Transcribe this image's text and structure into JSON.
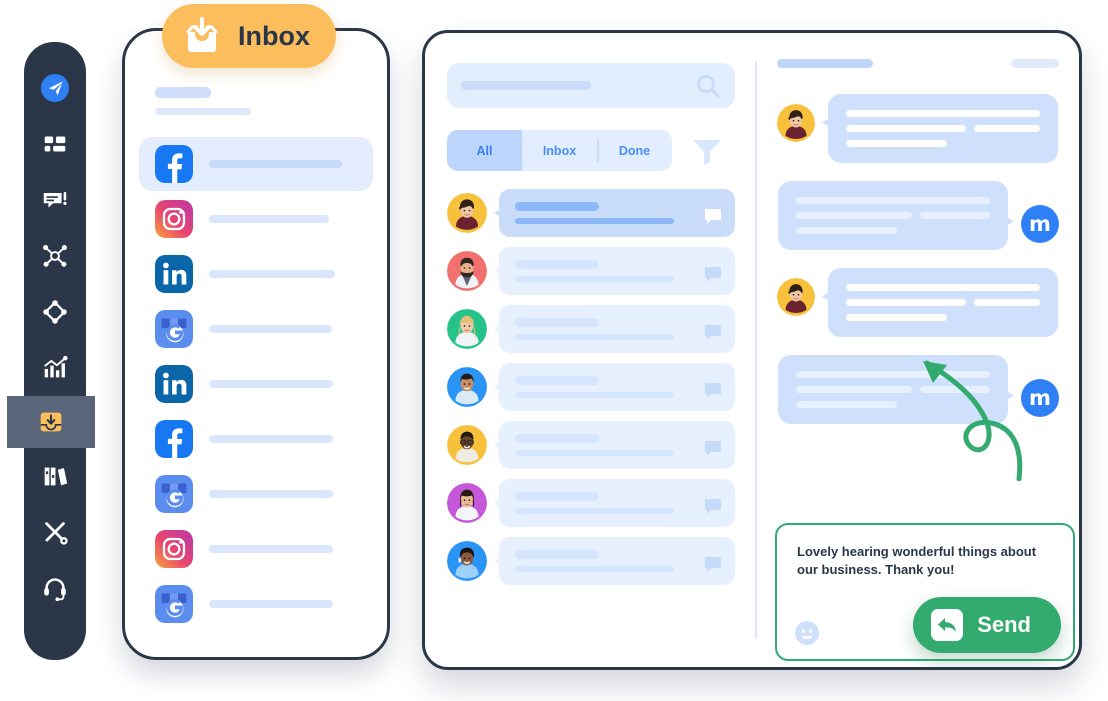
{
  "badge": {
    "label": "Inbox",
    "icon": "inbox-download-icon",
    "color": "#fcbe5d"
  },
  "sidebar": {
    "background": "#2b3749",
    "active_background": "#596579",
    "items": [
      {
        "icon": "send-paper-plane-icon",
        "active": false
      },
      {
        "icon": "dashboard-grid-icon",
        "active": false
      },
      {
        "icon": "messages-alert-icon",
        "active": false
      },
      {
        "icon": "network-share-icon",
        "active": false
      },
      {
        "icon": "diamond-target-icon",
        "active": false
      },
      {
        "icon": "analytics-chart-icon",
        "active": false
      },
      {
        "icon": "inbox-download-icon",
        "active": true
      },
      {
        "icon": "library-books-icon",
        "active": false
      },
      {
        "icon": "tools-wrench-icon",
        "active": false
      },
      {
        "icon": "support-headset-icon",
        "active": false
      }
    ]
  },
  "phone": {
    "title_placeholder": "",
    "subtitle_placeholder": "",
    "channels": [
      {
        "network": "facebook-icon",
        "active": true
      },
      {
        "network": "instagram-icon",
        "active": false
      },
      {
        "network": "linkedin-icon",
        "active": false
      },
      {
        "network": "google-business-icon",
        "active": false
      },
      {
        "network": "linkedin-icon",
        "active": false
      },
      {
        "network": "facebook-icon",
        "active": false
      },
      {
        "network": "google-business-icon",
        "active": false
      },
      {
        "network": "instagram-icon",
        "active": false
      },
      {
        "network": "google-business-icon",
        "active": false
      }
    ]
  },
  "tablet": {
    "search": {
      "icon": "search-icon",
      "value": "",
      "placeholder": ""
    },
    "tabs": [
      {
        "label": "All",
        "active": true
      },
      {
        "label": "Inbox",
        "active": false
      },
      {
        "label": "Done",
        "active": false
      }
    ],
    "filter_icon": "filter-funnel-icon",
    "conversations": [
      {
        "avatar_color": "#f7c13c",
        "active": true,
        "chat_icon": "chat-bubble-icon"
      },
      {
        "avatar_color": "#f2706e",
        "active": false,
        "chat_icon": "chat-bubble-icon"
      },
      {
        "avatar_color": "#25c389",
        "active": false,
        "chat_icon": "chat-bubble-icon"
      },
      {
        "avatar_color": "#2b95f5",
        "active": false,
        "chat_icon": "chat-bubble-icon"
      },
      {
        "avatar_color": "#f7c13c",
        "active": false,
        "chat_icon": "chat-bubble-icon"
      },
      {
        "avatar_color": "#c458d8",
        "active": false,
        "chat_icon": "chat-bubble-icon"
      },
      {
        "avatar_color": "#2b95f5",
        "active": false,
        "chat_icon": "chat-bubble-icon"
      }
    ],
    "chat": {
      "header": {
        "title_placeholder": "",
        "meta_placeholder": ""
      },
      "brand_initial": "m",
      "brand_color": "#2f80f5",
      "messages": [
        {
          "direction": "in",
          "avatar_color": "#f7c13c"
        },
        {
          "direction": "out",
          "avatar": "brand-logo"
        },
        {
          "direction": "in",
          "avatar_color": "#f7c13c"
        },
        {
          "direction": "out",
          "avatar": "brand-logo"
        }
      ],
      "composer": {
        "text": "Lovely hearing wonderful things about our business. Thank you!",
        "emoji_icon": "emoji-smiley-icon",
        "send_label": "Send",
        "send_icon": "reply-arrow-icon",
        "send_color": "#33ab6f",
        "border_color": "#2fab74"
      },
      "annotation_arrow": {
        "icon": "curved-arrow-icon",
        "color": "#33ab6f"
      }
    }
  }
}
